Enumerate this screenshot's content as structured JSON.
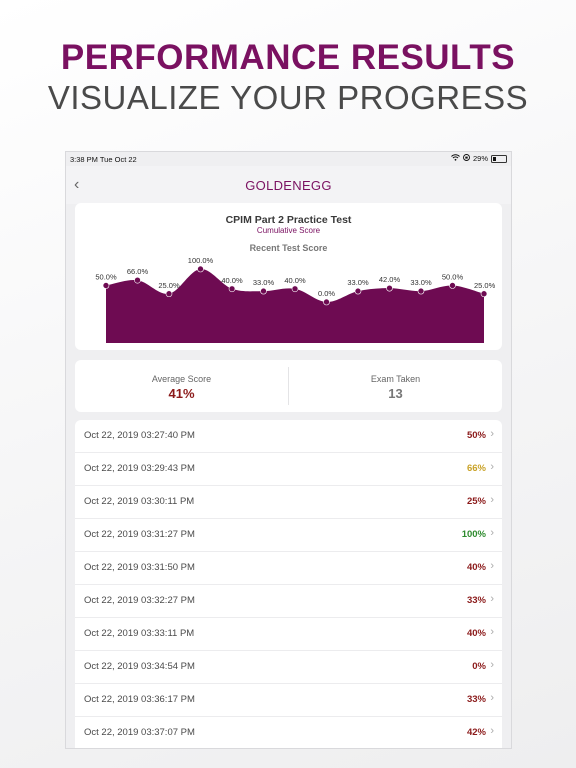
{
  "promo": {
    "title": "PERFORMANCE RESULTS",
    "subtitle": "VISUALIZE YOUR PROGRESS"
  },
  "status_bar": {
    "time": "3:38 PM   Tue Oct 22",
    "battery": "29%"
  },
  "nav": {
    "back_icon": "chevron-left-icon",
    "logo": "GOLDENEGG"
  },
  "chart_card": {
    "title": "CPIM Part 2 Practice Test",
    "subtitle": "Cumulative Score",
    "heading": "Recent Test Score"
  },
  "chart_data": {
    "type": "area",
    "title": "Recent Test Score",
    "values": [
      50,
      66,
      25,
      100,
      40,
      33,
      40,
      0,
      33,
      42,
      33,
      50,
      25
    ],
    "labels": [
      "50.0%",
      "66.0%",
      "25.0%",
      "100.0%",
      "40.0%",
      "33.0%",
      "40.0%",
      "0.0%",
      "33.0%",
      "42.0%",
      "33.0%",
      "50.0%",
      "25.0%"
    ],
    "ylim": [
      0,
      100
    ],
    "fill_color": "#6e0b52",
    "point_color": "#6e0b52"
  },
  "stats": {
    "average_label": "Average Score",
    "average_value": "41%",
    "average_color": "#8b1a1a",
    "exam_label": "Exam Taken",
    "exam_value": "13",
    "exam_color": "#777777"
  },
  "results": [
    {
      "date": "Oct 22, 2019 03:27:40 PM",
      "score": "50%",
      "color": "#8b1a1a"
    },
    {
      "date": "Oct 22, 2019 03:29:43 PM",
      "score": "66%",
      "color": "#c9a227"
    },
    {
      "date": "Oct 22, 2019 03:30:11 PM",
      "score": "25%",
      "color": "#8b1a1a"
    },
    {
      "date": "Oct 22, 2019 03:31:27 PM",
      "score": "100%",
      "color": "#2e8b2e"
    },
    {
      "date": "Oct 22, 2019 03:31:50 PM",
      "score": "40%",
      "color": "#8b1a1a"
    },
    {
      "date": "Oct 22, 2019 03:32:27 PM",
      "score": "33%",
      "color": "#8b1a1a"
    },
    {
      "date": "Oct 22, 2019 03:33:11 PM",
      "score": "40%",
      "color": "#8b1a1a"
    },
    {
      "date": "Oct 22, 2019 03:34:54 PM",
      "score": "0%",
      "color": "#8b1a1a"
    },
    {
      "date": "Oct 22, 2019 03:36:17 PM",
      "score": "33%",
      "color": "#8b1a1a"
    },
    {
      "date": "Oct 22, 2019 03:37:07 PM",
      "score": "42%",
      "color": "#8b1a1a"
    }
  ]
}
